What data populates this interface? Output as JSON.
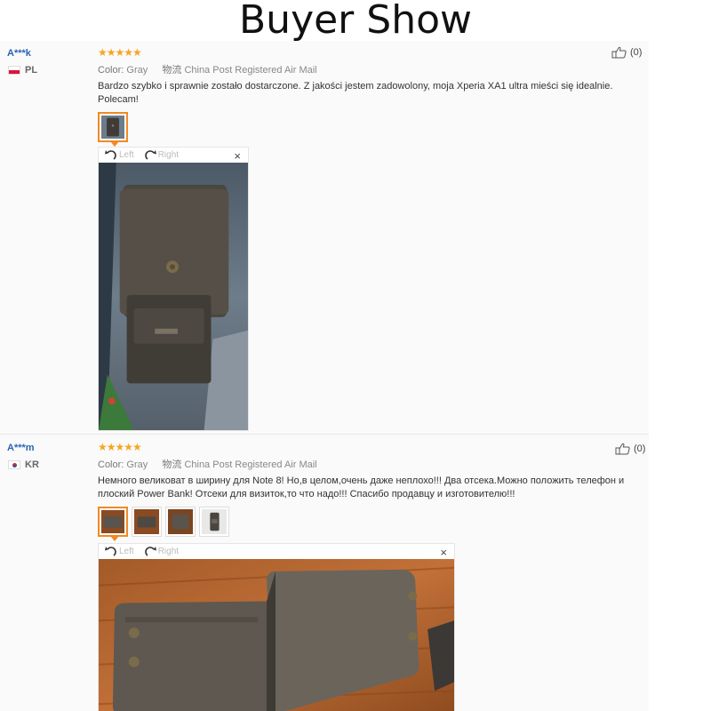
{
  "page": {
    "title": "Buyer Show"
  },
  "reviews": [
    {
      "user": "A***k",
      "country": "PL",
      "stars": "★★★★★",
      "color_label": "Color:",
      "color_value": "Gray",
      "shipping_label": "物流",
      "shipping_value": "China Post Registered Air Mail",
      "text": "Bardzo szybko i sprawnie zostało dostarczone. Z jakości jestem zadowolony, moja Xperia XA1 ultra mieści się idealnie. Polecam!",
      "likes": "(0)",
      "viewer": {
        "left": "Left",
        "right": "Right",
        "close": "×"
      }
    },
    {
      "user": "A***m",
      "country": "KR",
      "stars": "★★★★★",
      "color_label": "Color:",
      "color_value": "Gray",
      "shipping_label": "物流",
      "shipping_value": "China Post Registered Air Mail",
      "text": "Немного великоват в ширину для Note 8! Но,в целом,очень даже неплохо!!! Два отсека.Можно положить телефон и плоский Power Bank! Отсеки для визиток,то что надо!!! Спасибо продавцу и изготовителю!!!",
      "likes": "(0)",
      "viewer": {
        "left": "Left",
        "right": "Right",
        "close": "×"
      }
    }
  ],
  "colors": {
    "star": "#f5a623",
    "username": "#2a63b8",
    "selected_border": "#f08a24"
  },
  "icons": [
    "thumbs-up-icon",
    "rotate-left-icon",
    "rotate-right-icon",
    "close-icon",
    "flag-pl-icon",
    "flag-kr-icon"
  ]
}
